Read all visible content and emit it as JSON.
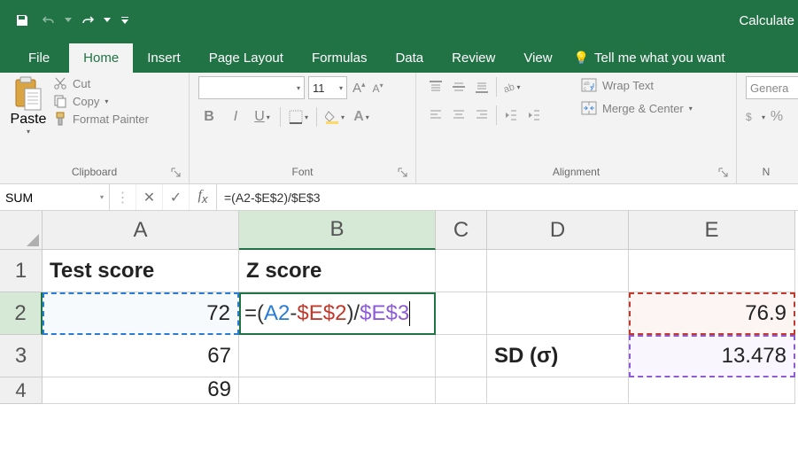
{
  "titlebar": {
    "right_text": "Calculate"
  },
  "tabs": {
    "file": "File",
    "home": "Home",
    "insert": "Insert",
    "page_layout": "Page Layout",
    "formulas": "Formulas",
    "data": "Data",
    "review": "Review",
    "view": "View",
    "tell_me": "Tell me what you want"
  },
  "ribbon": {
    "clipboard": {
      "paste": "Paste",
      "cut": "Cut",
      "copy": "Copy",
      "format_painter": "Format Painter",
      "group_label": "Clipboard"
    },
    "font": {
      "name": "",
      "size": "11",
      "group_label": "Font"
    },
    "alignment": {
      "wrap_text": "Wrap Text",
      "merge_center": "Merge & Center",
      "group_label": "Alignment"
    },
    "number": {
      "format_name": "Genera",
      "group_label": "N"
    }
  },
  "formula_bar": {
    "name_box": "SUM",
    "formula_plain": "=(A2-$E$2)/$E$3"
  },
  "grid": {
    "columns": {
      "A": "A",
      "B": "B",
      "C": "C",
      "D": "D",
      "E": "E"
    },
    "rows": {
      "r1": "1",
      "r2": "2",
      "r3": "3",
      "r4": "4"
    },
    "cells": {
      "A1": "Test score",
      "B1": "Z score",
      "A2": "72",
      "B2_eq": "=(",
      "B2_ref1": "A2",
      "B2_dash": "-",
      "B2_ref2": "$E$2",
      "B2_close": ")/",
      "B2_ref3": "$E$3",
      "E2": "76.9",
      "A3": "67",
      "D3": "SD (σ)",
      "E3": "13.478",
      "A4": "69"
    }
  },
  "chart_data": {
    "type": "table",
    "context": "Excel worksheet showing z-score calculation in progress (formula entry in B2)",
    "headers": {
      "A": "Test score",
      "B": "Z score"
    },
    "test_scores": [
      72,
      67,
      69
    ],
    "mean_cell": {
      "ref": "E2",
      "value": 76.9
    },
    "sd_cell": {
      "label": "SD (σ)",
      "ref": "E3",
      "value": 13.478
    },
    "formula_in_edit": "=(A2-$E$2)/$E$3",
    "active_cell": "B2",
    "name_box_value": "SUM"
  }
}
